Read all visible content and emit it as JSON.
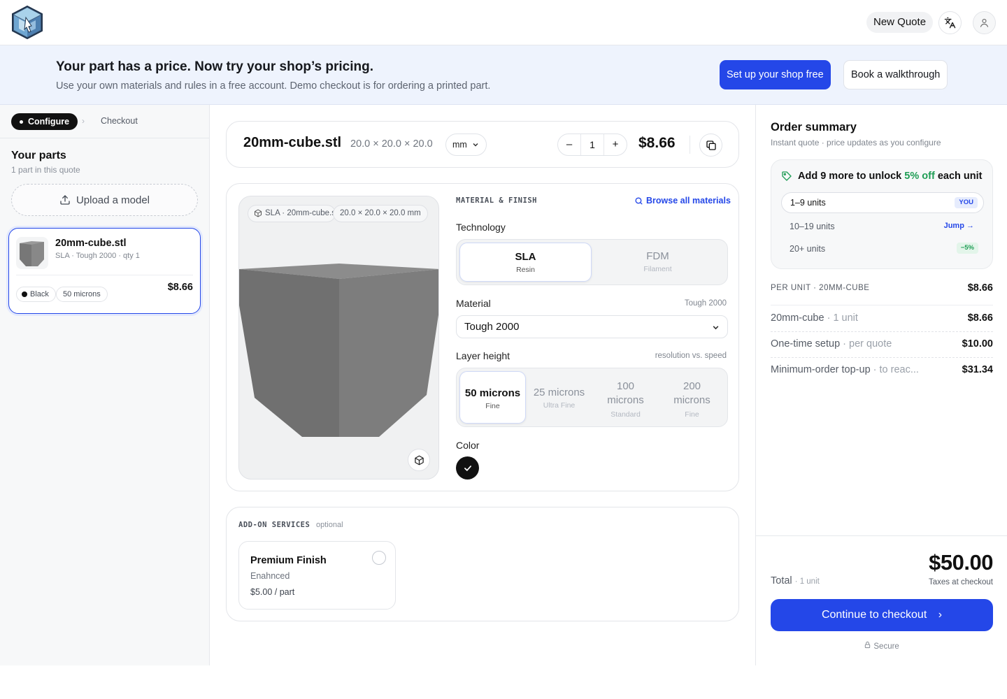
{
  "header": {
    "new_quote_label": "New Quote",
    "icons": [
      "logo-cube",
      "translate-icon",
      "user-icon"
    ]
  },
  "banner": {
    "title": "Your part has a price. Now try your shop’s pricing.",
    "subtitle": "Use your own materials and rules in a free account. Demo checkout is for ordering a printed part.",
    "primary_cta": "Set up your shop free",
    "secondary_cta": "Book a walkthrough"
  },
  "steps": {
    "active": "Configure",
    "separator": "›",
    "next": "Checkout"
  },
  "sidebar": {
    "title": "Your parts",
    "subtitle": "1 part in this quote",
    "upload_label": "Upload a model",
    "parts": [
      {
        "name": "20mm-cube.stl",
        "meta": "SLA · Tough 2000 · qty 1",
        "color_chip": "Black",
        "layer_chip": "50 microns",
        "price": "$8.66"
      }
    ]
  },
  "file": {
    "name": "20mm-cube.stl",
    "dims": "20.0 × 20.0 × 20.0",
    "unit": "mm",
    "qty": "1",
    "minus": "–",
    "plus": "+",
    "price": "$8.66"
  },
  "viewer": {
    "tag": "SLA · 20mm-cube.stl",
    "dims": "20.0 × 20.0 × 20.0 mm"
  },
  "config": {
    "section_label": "MATERIAL & FINISH",
    "browse_label": "Browse all materials",
    "technology_label": "Technology",
    "technology_options": [
      {
        "name": "SLA",
        "sub": "Resin",
        "selected": true
      },
      {
        "name": "FDM",
        "sub": "Filament",
        "selected": false
      }
    ],
    "material_label": "Material",
    "material_hint": "Tough 2000",
    "material_value": "Tough 2000",
    "layer_label": "Layer height",
    "layer_hint": "resolution vs. speed",
    "layer_options": [
      {
        "name": "50 microns",
        "sub": "Fine",
        "selected": true
      },
      {
        "name": "25 microns",
        "sub": "Ultra Fine",
        "selected": false
      },
      {
        "name": "100 microns",
        "sub": "Standard",
        "selected": false
      },
      {
        "name": "200 microns",
        "sub": "Fine",
        "selected": false
      }
    ],
    "color_label": "Color",
    "color_value": "#111111"
  },
  "addons": {
    "section_label": "ADD-ON SERVICES",
    "optional": "optional",
    "items": [
      {
        "title": "Premium Finish",
        "subtitle": "Enahnced",
        "price": "$5.00 / part"
      }
    ]
  },
  "summary": {
    "title": "Order summary",
    "subtitle": "Instant quote · price updates as you configure",
    "tier_head_pre": "Add 9 more to unlock",
    "tier_head_discount": "5% off",
    "tier_head_post": "each unit",
    "tiers": [
      {
        "range": "1–9 units",
        "badge": "YOU"
      },
      {
        "range": "10–19 units",
        "badge": "Jump →"
      },
      {
        "range": "20+ units",
        "badge": "−5%"
      }
    ],
    "per_unit_label": "PER UNIT · 20MM-CUBE",
    "per_unit_value": "$8.66",
    "lines": [
      {
        "label": "20mm-cube",
        "note": "· 1 unit",
        "amount": "$8.66"
      },
      {
        "label": "One-time setup",
        "note": "· per quote",
        "amount": "$10.00"
      },
      {
        "label": "Minimum-order top-up",
        "note": "· to reac...",
        "amount": "$31.34"
      }
    ],
    "total_label": "Total",
    "total_note": "· 1 unit",
    "total_amount": "$50.00",
    "tax_note": "Taxes at checkout",
    "checkout_label": "Continue to checkout",
    "checkout_arrow": "›",
    "secure_label": "Secure"
  },
  "colors": {
    "accent": "#2447e8",
    "banner_bg": "#eef3fd",
    "success": "#1f9d55"
  }
}
